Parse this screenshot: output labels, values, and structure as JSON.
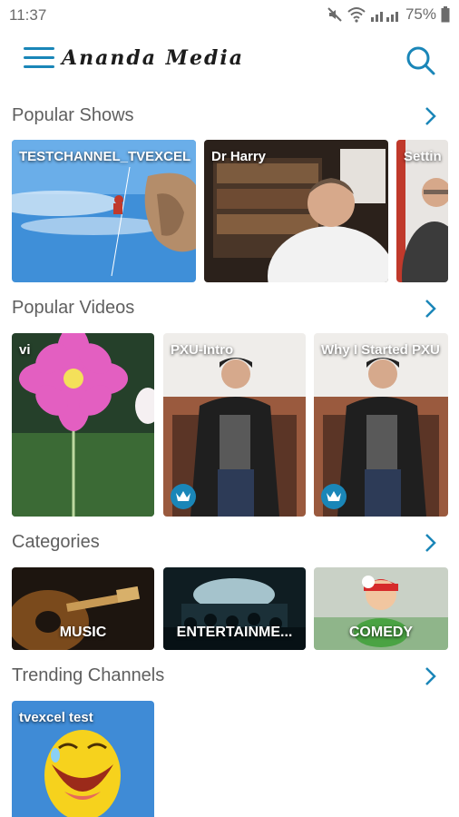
{
  "status_bar": {
    "time": "11:37",
    "battery": "75%"
  },
  "app_bar": {
    "title": "Ananda Media",
    "menu_icon": "hamburger-menu-icon",
    "search_icon": "search-icon"
  },
  "colors": {
    "accent": "#1a86b8",
    "section_title": "#5f5f5f"
  },
  "sections": {
    "popular_shows": {
      "title": "Popular Shows",
      "items": [
        {
          "label": "TESTCHANNEL_TVEXCEL"
        },
        {
          "label": "Dr Harry"
        },
        {
          "label": "Settin"
        }
      ]
    },
    "popular_videos": {
      "title": "Popular Videos",
      "items": [
        {
          "label": "vi",
          "premium": false
        },
        {
          "label": "PXU-Intro",
          "premium": true
        },
        {
          "label": "Why I Started PXU",
          "premium": true
        }
      ]
    },
    "categories": {
      "title": "Categories",
      "items": [
        {
          "label": "MUSIC"
        },
        {
          "label": "ENTERTAINME..."
        },
        {
          "label": "COMEDY"
        }
      ]
    },
    "trending_channels": {
      "title": "Trending Channels",
      "items": [
        {
          "label": "tvexcel test"
        }
      ]
    }
  }
}
